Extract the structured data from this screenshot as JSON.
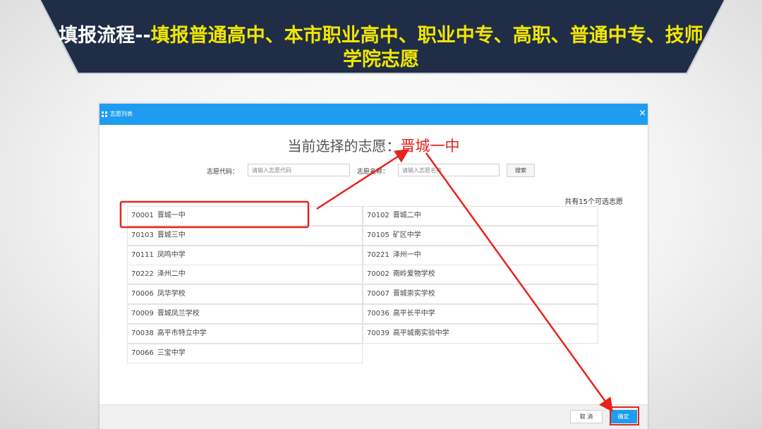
{
  "banner": {
    "title_lead": "填报流程--",
    "title_rest": "填报普通高中、本市职业高中、职业中专、高职、普通中专、技师学院志愿"
  },
  "dialog": {
    "title": "志愿列表",
    "close_symbol": "×",
    "heading_label": "当前选择的志愿：",
    "heading_selected": "晋城一中",
    "code_label": "志愿代码：",
    "code_placeholder": "请输入志愿代码",
    "name_label": "志愿名称：",
    "name_placeholder": "请输入志愿名称",
    "search_button": "搜索",
    "count_text": "共有15个可选志愿",
    "cancel_button": "取 消",
    "ok_button": "确定"
  },
  "options": [
    {
      "code": "70001",
      "name": "晋城一中"
    },
    {
      "code": "70102",
      "name": "晋城二中"
    },
    {
      "code": "70103",
      "name": "晋城三中"
    },
    {
      "code": "70105",
      "name": "矿区中学"
    },
    {
      "code": "70111",
      "name": "凤鸣中学"
    },
    {
      "code": "70221",
      "name": "泽州一中"
    },
    {
      "code": "70222",
      "name": "泽州二中"
    },
    {
      "code": "70002",
      "name": "南岭爱物学校"
    },
    {
      "code": "70006",
      "name": "凤华学校"
    },
    {
      "code": "70007",
      "name": "晋城崇实学校"
    },
    {
      "code": "70009",
      "name": "晋城凤兰学校"
    },
    {
      "code": "70036",
      "name": "高平长平中学"
    },
    {
      "code": "70038",
      "name": "高平市特立中学"
    },
    {
      "code": "70039",
      "name": "高平城南实验中学"
    },
    {
      "code": "70066",
      "name": "三宝中学"
    }
  ],
  "colors": {
    "banner_bg": "#1f2d47",
    "banner_title_accent": "#f2e600",
    "dialog_header": "#1e9cf0",
    "selected_text": "#e0231e",
    "annotation": "#e8231c"
  }
}
